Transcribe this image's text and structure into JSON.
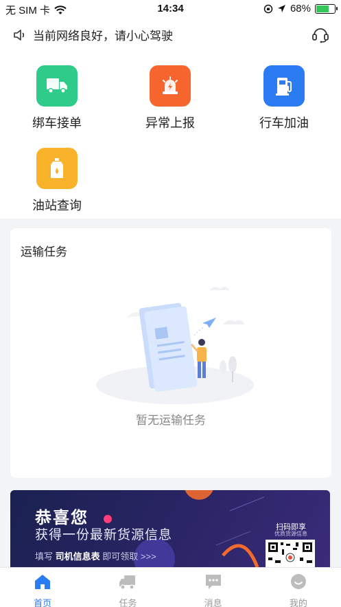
{
  "status_bar": {
    "carrier": "无 SIM 卡",
    "time": "14:34",
    "battery_percent": "68%",
    "battery_level": 0.68,
    "battery_color": "#34c759"
  },
  "notice": {
    "text": "当前网络良好，请小心驾驶",
    "speaker_icon": "speaker-icon",
    "service_icon": "headset-icon"
  },
  "features": [
    {
      "label": "绑车接单",
      "icon": "truck-icon",
      "color": "#2ecb8a"
    },
    {
      "label": "异常上报",
      "icon": "alarm-icon",
      "color": "#f6652e"
    },
    {
      "label": "行车加油",
      "icon": "fuel-pump-icon",
      "color": "#2b7bf3"
    },
    {
      "label": "油站查询",
      "icon": "oil-can-icon",
      "color": "#f8b32a"
    }
  ],
  "task_card": {
    "title": "运输任务",
    "empty_text": "暂无运输任务"
  },
  "banner": {
    "title": "恭喜您",
    "subtitle": "获得一份最新货源信息",
    "fill_prefix": "填写",
    "fill_highlight": "司机信息表",
    "fill_suffix": "即可领取 >>>",
    "qr_title": "扫码即享",
    "qr_subtitle": "优质货源信息"
  },
  "tabbar": {
    "active_color": "#2b7bf3",
    "tabs": [
      {
        "label": "首页",
        "icon": "home-icon",
        "active": true
      },
      {
        "label": "任务",
        "icon": "truck-icon",
        "active": false
      },
      {
        "label": "消息",
        "icon": "message-icon",
        "active": false
      },
      {
        "label": "我的",
        "icon": "smile-icon",
        "active": false
      }
    ]
  }
}
